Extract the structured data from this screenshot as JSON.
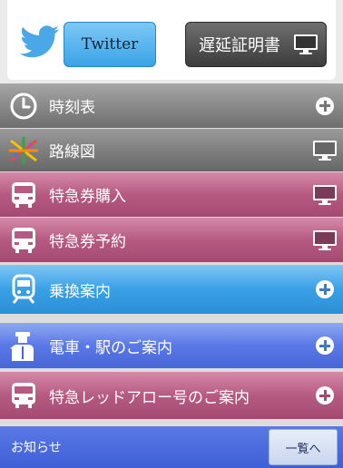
{
  "header": {
    "twitter_label": "Twitter",
    "delay_cert_label": "遅延証明書"
  },
  "menu": [
    {
      "label": "時刻表"
    },
    {
      "label": "路線図"
    },
    {
      "label": "特急券購入"
    },
    {
      "label": "特急券予約"
    },
    {
      "label": "乗換案内"
    },
    {
      "label": "電車・駅のご案内"
    },
    {
      "label": "特急レッドアロー号のご案内"
    }
  ],
  "news": {
    "label": "お知らせ",
    "more_label": "一覧へ"
  }
}
